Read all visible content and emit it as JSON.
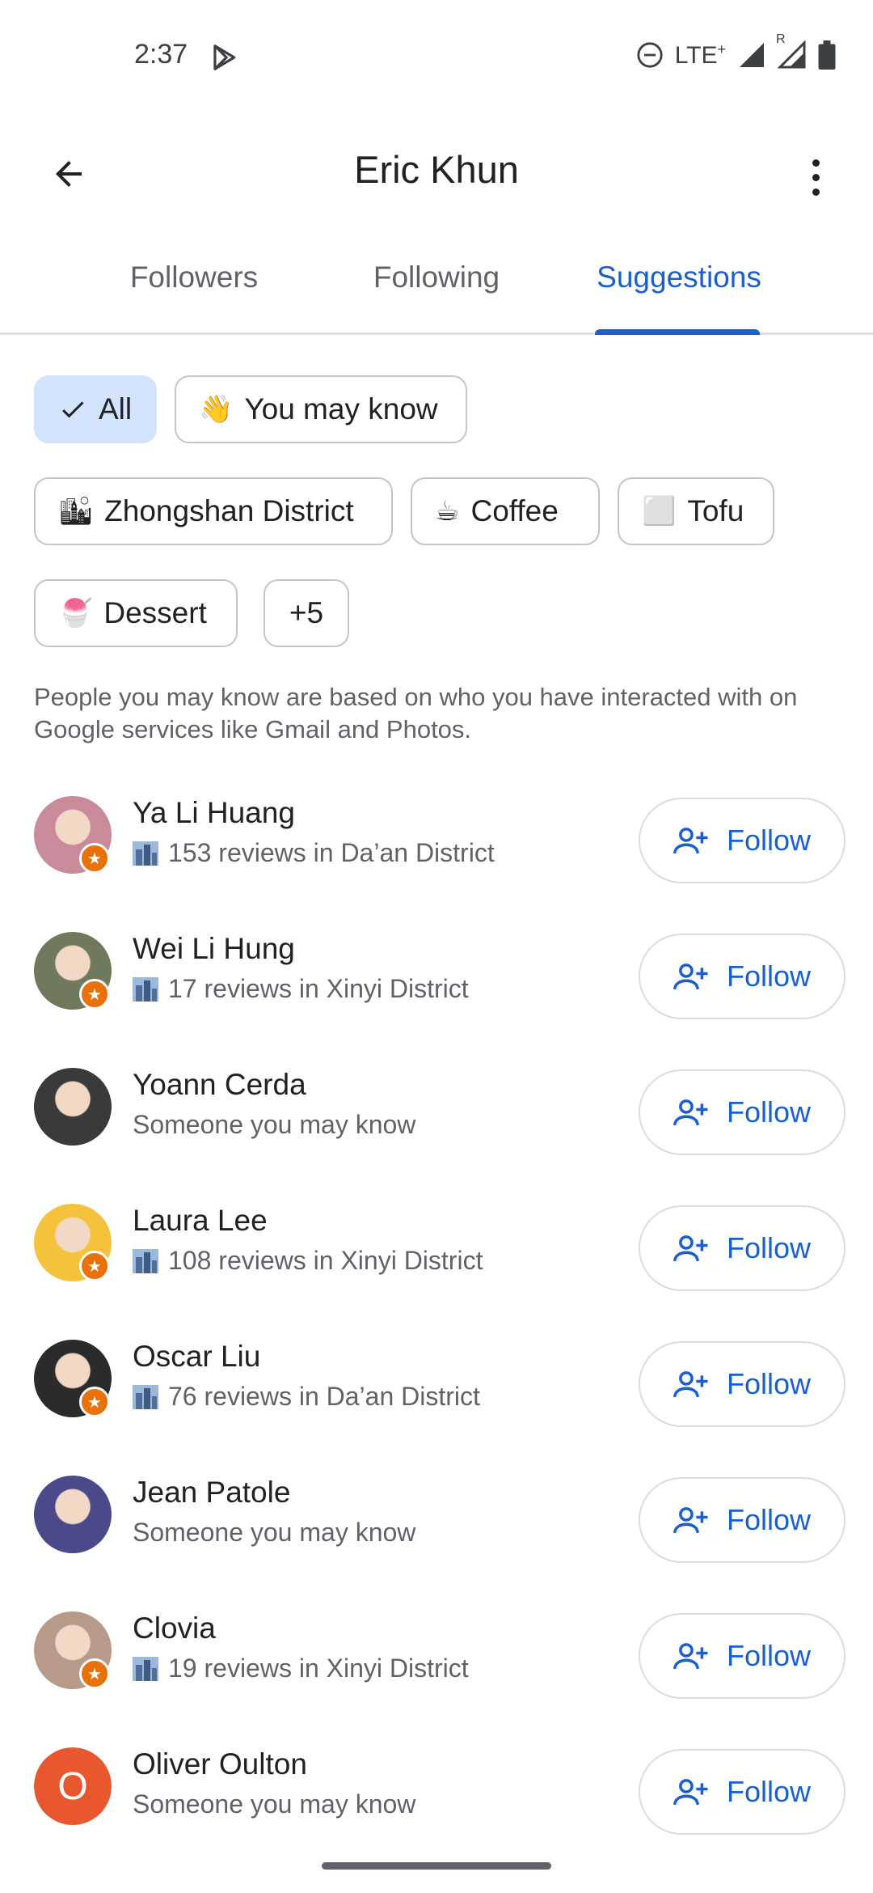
{
  "status_bar": {
    "time": "2:37",
    "network": "LTE",
    "network_plus": "+",
    "roaming": "R"
  },
  "header": {
    "title": "Eric Khun"
  },
  "tabs": [
    {
      "label": "Followers"
    },
    {
      "label": "Following"
    },
    {
      "label": "Suggestions"
    }
  ],
  "filters": {
    "all": "All",
    "you_may_know": {
      "emoji": "👋",
      "label": "You may know"
    },
    "zhongshan": {
      "emoji": "🏙",
      "label": "Zhongshan District"
    },
    "coffee": {
      "emoji": "☕",
      "label": "Coffee"
    },
    "tofu": {
      "emoji": "⬜",
      "label": "Tofu"
    },
    "dessert": {
      "emoji": "🍧",
      "label": "Dessert"
    },
    "more": "+5"
  },
  "info_text": "People you may know are based on who you have interacted with on Google services like Gmail and Photos.",
  "follow_label": "Follow",
  "people": [
    {
      "name": "Ya Li Huang",
      "subtitle": "153 reviews in Da’an District",
      "local_guide": true,
      "avatar_color": "#c98b9a"
    },
    {
      "name": "Wei Li Hung",
      "subtitle": "17 reviews in Xinyi District",
      "local_guide": true,
      "avatar_color": "#6f7a5c"
    },
    {
      "name": "Yoann Cerda",
      "subtitle": "Someone you may know",
      "local_guide": false,
      "avatar_color": "#3a3a3a"
    },
    {
      "name": "Laura Lee",
      "subtitle": "108 reviews in Xinyi District",
      "local_guide": true,
      "avatar_color": "#f5c33b"
    },
    {
      "name": "Oscar Liu",
      "subtitle": "76 reviews in Da’an District",
      "local_guide": true,
      "avatar_color": "#2b2b2b"
    },
    {
      "name": "Jean Patole",
      "subtitle": "Someone you may know",
      "local_guide": false,
      "avatar_color": "#4a4a8a"
    },
    {
      "name": "Clovia",
      "subtitle": "19 reviews in Xinyi District",
      "local_guide": true,
      "avatar_color": "#b89a8a"
    },
    {
      "name": "Oliver Oulton",
      "subtitle": "Someone you may know",
      "local_guide": false,
      "avatar_initial": "O",
      "avatar_color": "#e8572e"
    }
  ],
  "colors": {
    "accent": "#1a5fd0",
    "chip_selected": "#d3e3fd",
    "local_guide_badge": "#e8710a"
  }
}
